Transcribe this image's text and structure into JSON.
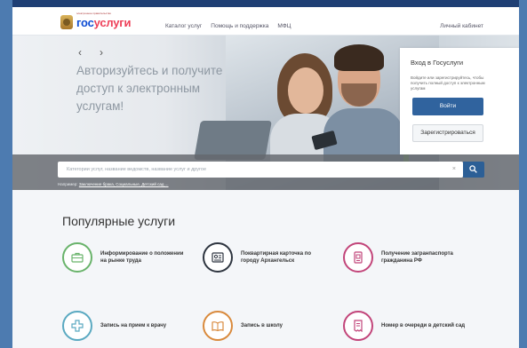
{
  "header": {
    "logo_part1": "гос",
    "logo_part2": "услуги",
    "logo_subtitle": "электронное правительство",
    "nav": [
      "Каталог услуг",
      "Помощь и поддержка",
      "МФЦ"
    ],
    "cabinet": "Личный кабинет"
  },
  "hero": {
    "prev": "‹",
    "next": "›",
    "line1": "Авторизуйтесь и получите",
    "line2": "доступ к электронным",
    "line3": "услугам!"
  },
  "login": {
    "title": "Вход в Госуслуги",
    "description": "Войдите или зарегистрируйтесь, чтобы получить полный доступ к электронным услугам",
    "login_button": "Войти",
    "register_button": "Зарегистрироваться"
  },
  "search": {
    "placeholder": "Категории услуг, название ведомств, название услуг и другое",
    "clear": "×",
    "hint_prefix": "Например:",
    "hint_links": "Заключение брака, Социальные, Детский сад ..."
  },
  "popular": {
    "title": "Популярные услуги",
    "services": [
      {
        "label1": "Информирование о положении",
        "label2": "на рынке труда",
        "color": "#69b36b",
        "icon": "briefcase-icon"
      },
      {
        "label1": "Поквартирная карточка по",
        "label2": "городу Архангельск",
        "color": "#2e3540",
        "icon": "id-card-icon"
      },
      {
        "label1": "Получение загранпаспорта",
        "label2": "гражданина РФ",
        "color": "#c2457a",
        "icon": "passport-icon"
      },
      {
        "label1": "Запись на прием к врачу",
        "label2": "",
        "color": "#5aa9c1",
        "icon": "medical-cross-icon"
      },
      {
        "label1": "Запись в школу",
        "label2": "",
        "color": "#d98a3d",
        "icon": "book-icon"
      },
      {
        "label1": "Номер в очереди в детский сад",
        "label2": "",
        "color": "#c2457a",
        "icon": "queue-ticket-icon"
      }
    ]
  }
}
